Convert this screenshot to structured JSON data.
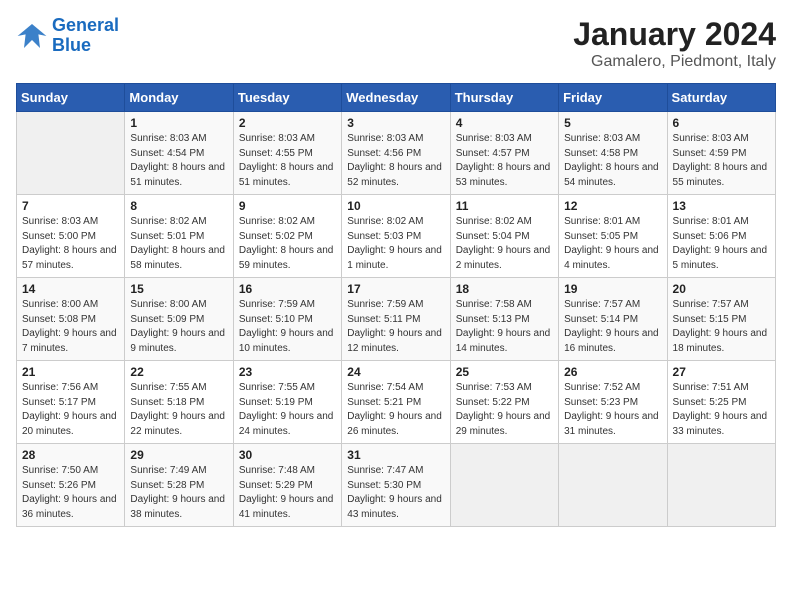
{
  "header": {
    "logo_line1": "General",
    "logo_line2": "Blue",
    "title": "January 2024",
    "subtitle": "Gamalero, Piedmont, Italy"
  },
  "weekdays": [
    "Sunday",
    "Monday",
    "Tuesday",
    "Wednesday",
    "Thursday",
    "Friday",
    "Saturday"
  ],
  "weeks": [
    [
      {
        "day": "",
        "sunrise": "",
        "sunset": "",
        "daylight": ""
      },
      {
        "day": "1",
        "sunrise": "Sunrise: 8:03 AM",
        "sunset": "Sunset: 4:54 PM",
        "daylight": "Daylight: 8 hours and 51 minutes."
      },
      {
        "day": "2",
        "sunrise": "Sunrise: 8:03 AM",
        "sunset": "Sunset: 4:55 PM",
        "daylight": "Daylight: 8 hours and 51 minutes."
      },
      {
        "day": "3",
        "sunrise": "Sunrise: 8:03 AM",
        "sunset": "Sunset: 4:56 PM",
        "daylight": "Daylight: 8 hours and 52 minutes."
      },
      {
        "day": "4",
        "sunrise": "Sunrise: 8:03 AM",
        "sunset": "Sunset: 4:57 PM",
        "daylight": "Daylight: 8 hours and 53 minutes."
      },
      {
        "day": "5",
        "sunrise": "Sunrise: 8:03 AM",
        "sunset": "Sunset: 4:58 PM",
        "daylight": "Daylight: 8 hours and 54 minutes."
      },
      {
        "day": "6",
        "sunrise": "Sunrise: 8:03 AM",
        "sunset": "Sunset: 4:59 PM",
        "daylight": "Daylight: 8 hours and 55 minutes."
      }
    ],
    [
      {
        "day": "7",
        "sunrise": "Sunrise: 8:03 AM",
        "sunset": "Sunset: 5:00 PM",
        "daylight": "Daylight: 8 hours and 57 minutes."
      },
      {
        "day": "8",
        "sunrise": "Sunrise: 8:02 AM",
        "sunset": "Sunset: 5:01 PM",
        "daylight": "Daylight: 8 hours and 58 minutes."
      },
      {
        "day": "9",
        "sunrise": "Sunrise: 8:02 AM",
        "sunset": "Sunset: 5:02 PM",
        "daylight": "Daylight: 8 hours and 59 minutes."
      },
      {
        "day": "10",
        "sunrise": "Sunrise: 8:02 AM",
        "sunset": "Sunset: 5:03 PM",
        "daylight": "Daylight: 9 hours and 1 minute."
      },
      {
        "day": "11",
        "sunrise": "Sunrise: 8:02 AM",
        "sunset": "Sunset: 5:04 PM",
        "daylight": "Daylight: 9 hours and 2 minutes."
      },
      {
        "day": "12",
        "sunrise": "Sunrise: 8:01 AM",
        "sunset": "Sunset: 5:05 PM",
        "daylight": "Daylight: 9 hours and 4 minutes."
      },
      {
        "day": "13",
        "sunrise": "Sunrise: 8:01 AM",
        "sunset": "Sunset: 5:06 PM",
        "daylight": "Daylight: 9 hours and 5 minutes."
      }
    ],
    [
      {
        "day": "14",
        "sunrise": "Sunrise: 8:00 AM",
        "sunset": "Sunset: 5:08 PM",
        "daylight": "Daylight: 9 hours and 7 minutes."
      },
      {
        "day": "15",
        "sunrise": "Sunrise: 8:00 AM",
        "sunset": "Sunset: 5:09 PM",
        "daylight": "Daylight: 9 hours and 9 minutes."
      },
      {
        "day": "16",
        "sunrise": "Sunrise: 7:59 AM",
        "sunset": "Sunset: 5:10 PM",
        "daylight": "Daylight: 9 hours and 10 minutes."
      },
      {
        "day": "17",
        "sunrise": "Sunrise: 7:59 AM",
        "sunset": "Sunset: 5:11 PM",
        "daylight": "Daylight: 9 hours and 12 minutes."
      },
      {
        "day": "18",
        "sunrise": "Sunrise: 7:58 AM",
        "sunset": "Sunset: 5:13 PM",
        "daylight": "Daylight: 9 hours and 14 minutes."
      },
      {
        "day": "19",
        "sunrise": "Sunrise: 7:57 AM",
        "sunset": "Sunset: 5:14 PM",
        "daylight": "Daylight: 9 hours and 16 minutes."
      },
      {
        "day": "20",
        "sunrise": "Sunrise: 7:57 AM",
        "sunset": "Sunset: 5:15 PM",
        "daylight": "Daylight: 9 hours and 18 minutes."
      }
    ],
    [
      {
        "day": "21",
        "sunrise": "Sunrise: 7:56 AM",
        "sunset": "Sunset: 5:17 PM",
        "daylight": "Daylight: 9 hours and 20 minutes."
      },
      {
        "day": "22",
        "sunrise": "Sunrise: 7:55 AM",
        "sunset": "Sunset: 5:18 PM",
        "daylight": "Daylight: 9 hours and 22 minutes."
      },
      {
        "day": "23",
        "sunrise": "Sunrise: 7:55 AM",
        "sunset": "Sunset: 5:19 PM",
        "daylight": "Daylight: 9 hours and 24 minutes."
      },
      {
        "day": "24",
        "sunrise": "Sunrise: 7:54 AM",
        "sunset": "Sunset: 5:21 PM",
        "daylight": "Daylight: 9 hours and 26 minutes."
      },
      {
        "day": "25",
        "sunrise": "Sunrise: 7:53 AM",
        "sunset": "Sunset: 5:22 PM",
        "daylight": "Daylight: 9 hours and 29 minutes."
      },
      {
        "day": "26",
        "sunrise": "Sunrise: 7:52 AM",
        "sunset": "Sunset: 5:23 PM",
        "daylight": "Daylight: 9 hours and 31 minutes."
      },
      {
        "day": "27",
        "sunrise": "Sunrise: 7:51 AM",
        "sunset": "Sunset: 5:25 PM",
        "daylight": "Daylight: 9 hours and 33 minutes."
      }
    ],
    [
      {
        "day": "28",
        "sunrise": "Sunrise: 7:50 AM",
        "sunset": "Sunset: 5:26 PM",
        "daylight": "Daylight: 9 hours and 36 minutes."
      },
      {
        "day": "29",
        "sunrise": "Sunrise: 7:49 AM",
        "sunset": "Sunset: 5:28 PM",
        "daylight": "Daylight: 9 hours and 38 minutes."
      },
      {
        "day": "30",
        "sunrise": "Sunrise: 7:48 AM",
        "sunset": "Sunset: 5:29 PM",
        "daylight": "Daylight: 9 hours and 41 minutes."
      },
      {
        "day": "31",
        "sunrise": "Sunrise: 7:47 AM",
        "sunset": "Sunset: 5:30 PM",
        "daylight": "Daylight: 9 hours and 43 minutes."
      },
      {
        "day": "",
        "sunrise": "",
        "sunset": "",
        "daylight": ""
      },
      {
        "day": "",
        "sunrise": "",
        "sunset": "",
        "daylight": ""
      },
      {
        "day": "",
        "sunrise": "",
        "sunset": "",
        "daylight": ""
      }
    ]
  ]
}
